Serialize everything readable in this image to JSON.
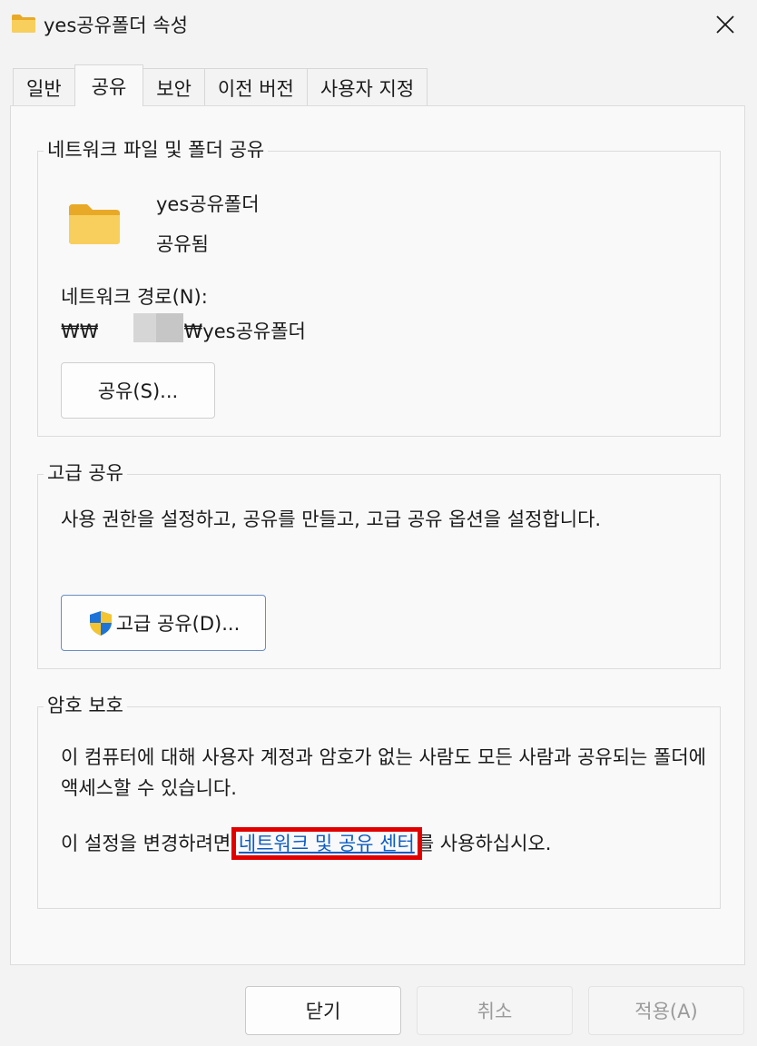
{
  "window": {
    "title": "yes공유폴더 속성"
  },
  "tabs": [
    {
      "label": "일반"
    },
    {
      "label": "공유"
    },
    {
      "label": "보안"
    },
    {
      "label": "이전 버전"
    },
    {
      "label": "사용자 지정"
    }
  ],
  "active_tab": "공유",
  "network_sharing": {
    "title": "네트워크 파일 및 폴더 공유",
    "folder_name": "yes공유폴더",
    "status": "공유됨",
    "path_label": "네트워크 경로(N):",
    "path_prefix": "₩₩",
    "path_suffix": "₩yes공유폴더",
    "share_button": "공유(S)..."
  },
  "advanced_sharing": {
    "title": "고급 공유",
    "description": "사용 권한을 설정하고, 공유를 만들고, 고급 공유 옵션을 설정합니다.",
    "button": "고급 공유(D)..."
  },
  "password_protection": {
    "title": "암호 보호",
    "description": "이 컴퓨터에 대해 사용자 계정과 암호가 없는 사람도 모든 사람과 공유되는 폴더에 액세스할 수 있습니다.",
    "change_prefix": "이 설정을 변경하려면 ",
    "link_text": "네트워크 및 공유 센터",
    "change_suffix": "를 사용하십시오."
  },
  "footer": {
    "ok": "닫기",
    "cancel": "취소",
    "apply": "적용(A)"
  },
  "colors": {
    "link": "#0a5cc5",
    "highlight": "#e00000",
    "folder": "#f6c752"
  }
}
